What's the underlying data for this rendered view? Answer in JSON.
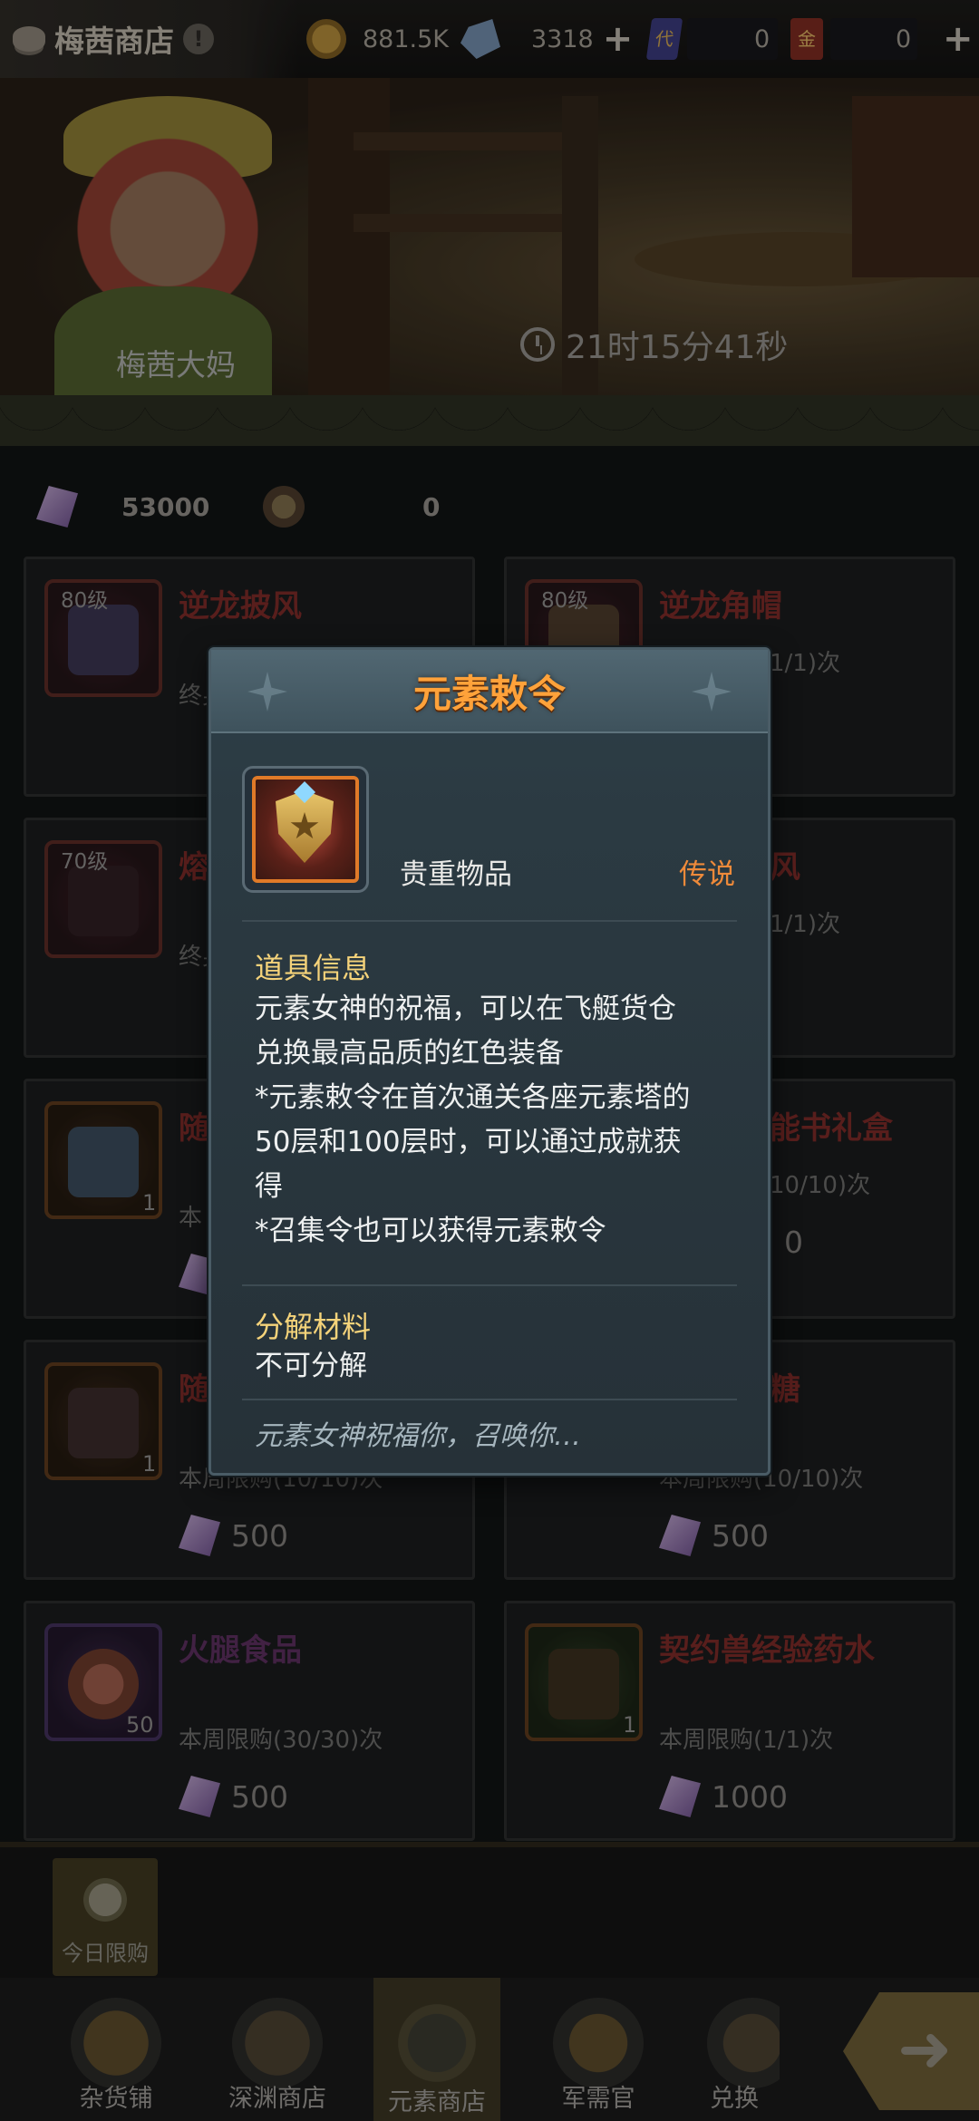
{
  "topbar": {
    "shop_title": "梅茜商店",
    "info_icon_label": "!",
    "gold": "881.5K",
    "diamond": "3318",
    "ticket_a": "0",
    "ticket_b": "0",
    "ticket_a_icon_text": "代",
    "ticket_b_icon_text": "金",
    "plus_label": "+"
  },
  "banner": {
    "npc_name": "梅茜大妈",
    "timer": "21时15分41秒"
  },
  "currency": {
    "gem_amount": "53000",
    "badge_amount": "0"
  },
  "cards": [
    {
      "level": "80级",
      "name": "逆龙披风",
      "limit": "终身",
      "count": "",
      "price": "",
      "name_color": "red"
    },
    {
      "level": "80级",
      "name": "逆龙角帽",
      "limit": "1/1)次",
      "count": "",
      "price": "",
      "name_color": "red"
    },
    {
      "level": "70级",
      "name": "熔",
      "limit": "终身",
      "count": "",
      "price": "",
      "name_color": "red"
    },
    {
      "level": "",
      "name": "风",
      "limit": "1/1)次",
      "count": "",
      "price": "",
      "name_color": "red"
    },
    {
      "level": "",
      "name": "随",
      "limit": "本",
      "count": "1",
      "price": "",
      "name_color": "red"
    },
    {
      "level": "",
      "name": "能书礼盒",
      "limit": "10/10)次",
      "count": "",
      "price": "0",
      "name_color": "red"
    },
    {
      "level": "",
      "name": "随",
      "limit": "本周限购(10/10)次",
      "count": "1",
      "price": "500",
      "name_color": "red"
    },
    {
      "level": "",
      "name": "糖",
      "limit": "本周限购(10/10)次",
      "count": "",
      "price": "500",
      "name_color": "red"
    },
    {
      "level": "",
      "name": "火腿食品",
      "limit": "本周限购(30/30)次",
      "count": "50",
      "price": "500",
      "name_color": "purple"
    },
    {
      "level": "",
      "name": "契约兽经验药水",
      "limit": "本周限购(1/1)次",
      "count": "1",
      "price": "1000",
      "name_color": "red"
    }
  ],
  "filter": {
    "today_limit": "今日限购"
  },
  "nav": [
    {
      "label": "杂货铺",
      "active": false
    },
    {
      "label": "深渊商店",
      "active": false
    },
    {
      "label": "元素商店",
      "active": true
    },
    {
      "label": "军需官",
      "active": false
    },
    {
      "label": "兑换",
      "active": false
    }
  ],
  "modal": {
    "title": "元素敕令",
    "category": "贵重物品",
    "rarity": "传说",
    "info_title": "道具信息",
    "info_lines": [
      "元素女神的祝福，可以在飞艇货仓",
      "兑换最高品质的红色装备",
      "*元素敕令在首次通关各座元素塔的",
      "50层和100层时，可以通过成就获",
      "得",
      "*召集令也可以获得元素敕令"
    ],
    "decompose_title": "分解材料",
    "decompose_text": "不可分解",
    "flavor": "元素女神祝福你，召唤你…"
  },
  "colors": {
    "title_orange": "#ffa23a",
    "rarity_orange": "#ee8a3a",
    "section_gold": "#f5d37a",
    "modal_bg": "#2b3a42"
  }
}
